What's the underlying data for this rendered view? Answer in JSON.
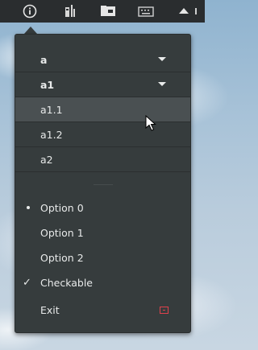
{
  "panel": {
    "icons": [
      "info-icon",
      "volume-icon",
      "folder-icon",
      "keyboard-icon",
      "tray-expand-icon"
    ]
  },
  "menu": {
    "items": [
      {
        "label": "a",
        "type": "submenu",
        "expanded": true
      },
      {
        "label": "a1",
        "type": "submenu",
        "expanded": true
      },
      {
        "label": "a1.1",
        "type": "item",
        "highlighted": true
      },
      {
        "label": "a1.2",
        "type": "item"
      },
      {
        "label": "a2",
        "type": "item"
      }
    ],
    "options": [
      {
        "label": "Option 0",
        "selected": true
      },
      {
        "label": "Option 1",
        "selected": false
      },
      {
        "label": "Option 2",
        "selected": false
      }
    ],
    "checkable": {
      "label": "Checkable",
      "checked": true,
      "check_glyph": "✓"
    },
    "exit": {
      "label": "Exit",
      "icon": "exit-icon",
      "icon_color": "#e0414c"
    }
  },
  "colors": {
    "menu_bg": "#363c3d",
    "highlight": "#4a5052",
    "panel_bg": "#2a2d2f"
  }
}
